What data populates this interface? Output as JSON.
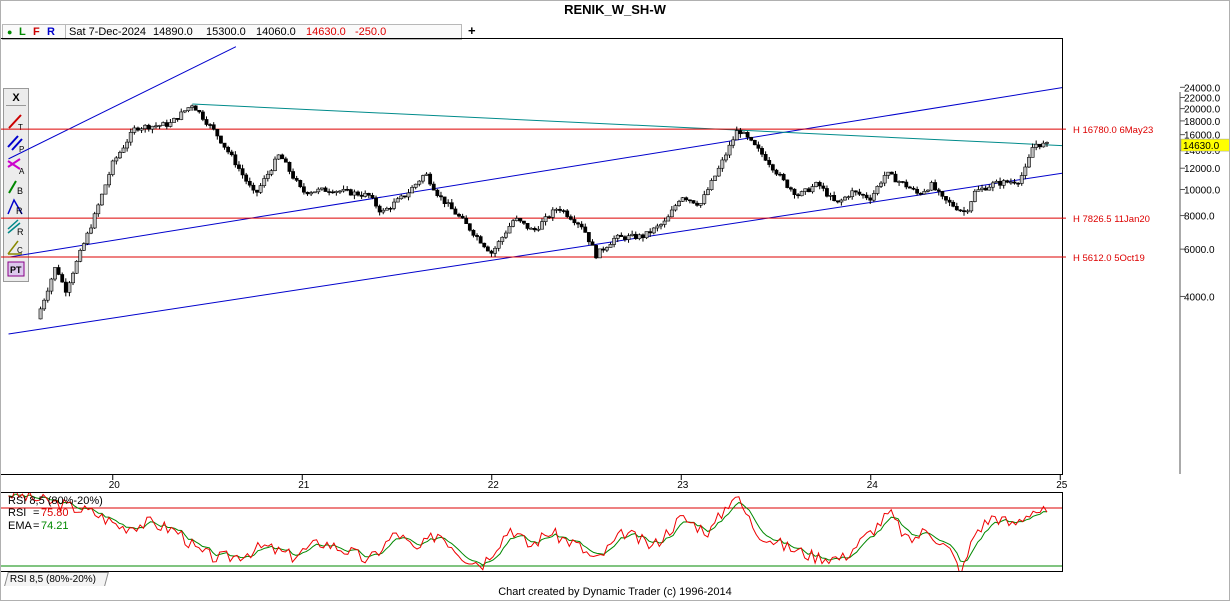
{
  "title": "RENIK_W_SH-W",
  "info_bar": {
    "dot": "●",
    "letters": [
      "L",
      "F",
      "R"
    ],
    "date": "Sat 7-Dec-2024",
    "open": "14890.0",
    "high": "15300.0",
    "low": "14060.0",
    "close": "14630.0",
    "change": "-250.0"
  },
  "add_symbol": "+",
  "toolbar": {
    "close": "X",
    "tools": [
      {
        "name": "trend-line-tool",
        "label": "T",
        "color": "#cc0000"
      },
      {
        "name": "parallel-line-tool",
        "label": "P",
        "color": "#0000cc"
      },
      {
        "name": "arc-tool",
        "label": "A",
        "color": "#cc00cc"
      },
      {
        "name": "b-tool",
        "label": "B",
        "color": "#008800"
      },
      {
        "name": "retrace-tool",
        "label": "R",
        "color": "#0000cc"
      },
      {
        "name": "ratio-tool",
        "label": "R",
        "color": "#008888"
      },
      {
        "name": "cycle-tool",
        "label": "C",
        "color": "#888800"
      },
      {
        "name": "pattern-tool",
        "label": "PT",
        "color": "#880088"
      }
    ]
  },
  "colors": {
    "bull": "#c0c0c0",
    "bear": "#000000",
    "channel": "#0000cc",
    "trendline": "#008b8b",
    "level": "#dd0000",
    "rsi": "#ee0000",
    "ema": "#008800",
    "last_price_bg": "#ffff00"
  },
  "chart_data": [
    {
      "type": "candlestick",
      "title": "RENIK_W_SH-W",
      "y_scale": "log",
      "ylim": [
        2900,
        26000
      ],
      "y_ticks": [
        "24000.0",
        "22000.0",
        "20000.0",
        "18000.0",
        "16000.0",
        "14000.0",
        "12000.0",
        "10000.0",
        "8000.0",
        "6000.0",
        "4000.0"
      ],
      "x_ticks": [
        "20",
        "21",
        "22",
        "23",
        "24",
        "25"
      ],
      "last_price": "14630.0",
      "levels": [
        {
          "value": 16780.0,
          "label": "H 16780.0 6May23"
        },
        {
          "value": 7826.5,
          "label": "H 7826.5 11Jan20"
        },
        {
          "value": 5612.0,
          "label": "H 5612.0 5Oct19"
        }
      ],
      "path": [
        [
          2019.6,
          3300
        ],
        [
          2019.7,
          5200
        ],
        [
          2019.75,
          4200
        ],
        [
          2019.82,
          5600
        ],
        [
          2019.9,
          7800
        ],
        [
          2020.0,
          12500
        ],
        [
          2020.12,
          17000
        ],
        [
          2020.3,
          17500
        ],
        [
          2020.42,
          20800
        ],
        [
          2020.55,
          16000
        ],
        [
          2020.65,
          12500
        ],
        [
          2020.75,
          9500
        ],
        [
          2020.88,
          13500
        ],
        [
          2021.0,
          9800
        ],
        [
          2021.15,
          10000
        ],
        [
          2021.35,
          9500
        ],
        [
          2021.42,
          8200
        ],
        [
          2021.55,
          9600
        ],
        [
          2021.65,
          11500
        ],
        [
          2021.72,
          9500
        ],
        [
          2021.85,
          7600
        ],
        [
          2022.0,
          5800
        ],
        [
          2022.12,
          7800
        ],
        [
          2022.22,
          7000
        ],
        [
          2022.35,
          8600
        ],
        [
          2022.48,
          7300
        ],
        [
          2022.55,
          5700
        ],
        [
          2022.65,
          6600
        ],
        [
          2022.8,
          6700
        ],
        [
          2022.92,
          7600
        ],
        [
          2023.0,
          9500
        ],
        [
          2023.1,
          8800
        ],
        [
          2023.2,
          12000
        ],
        [
          2023.3,
          16800
        ],
        [
          2023.45,
          13000
        ],
        [
          2023.55,
          10500
        ],
        [
          2023.62,
          9500
        ],
        [
          2023.72,
          10500
        ],
        [
          2023.82,
          8800
        ],
        [
          2023.9,
          9800
        ],
        [
          2024.0,
          9300
        ],
        [
          2024.08,
          11500
        ],
        [
          2024.2,
          10200
        ],
        [
          2024.25,
          9600
        ],
        [
          2024.32,
          10400
        ],
        [
          2024.38,
          9200
        ],
        [
          2024.45,
          8600
        ],
        [
          2024.5,
          8200
        ],
        [
          2024.55,
          9800
        ],
        [
          2024.65,
          10500
        ],
        [
          2024.78,
          10800
        ],
        [
          2024.82,
          12000
        ],
        [
          2024.86,
          14800
        ],
        [
          2024.93,
          14630
        ]
      ],
      "annotations": [
        {
          "type": "channel-line",
          "from": [
            2019.45,
            13000
          ],
          "to": [
            2020.65,
            34000
          ]
        },
        {
          "type": "channel-line",
          "from": [
            2019.45,
            5600
          ],
          "to": [
            2025.25,
            25500
          ]
        },
        {
          "type": "channel-line",
          "from": [
            2019.45,
            2900
          ],
          "to": [
            2025.25,
            12200
          ]
        },
        {
          "type": "trend-line",
          "from": [
            2020.42,
            20800
          ],
          "to": [
            2025.25,
            14300
          ]
        }
      ]
    },
    {
      "type": "line",
      "title": "RSI 8,5 (80%-20%)",
      "series": [
        {
          "name": "RSI",
          "value": "75.80"
        },
        {
          "name": "EMA",
          "value": "74.21"
        }
      ],
      "ylim": [
        0,
        100
      ],
      "bands": [
        80,
        20
      ],
      "path": [
        [
          2019.45,
          95
        ],
        [
          2019.7,
          85
        ],
        [
          2019.9,
          75
        ],
        [
          2020.05,
          60
        ],
        [
          2020.2,
          65
        ],
        [
          2020.35,
          55
        ],
        [
          2020.45,
          35
        ],
        [
          2020.55,
          28
        ],
        [
          2020.65,
          30
        ],
        [
          2020.8,
          40
        ],
        [
          2020.95,
          30
        ],
        [
          2021.1,
          45
        ],
        [
          2021.25,
          35
        ],
        [
          2021.35,
          25
        ],
        [
          2021.5,
          55
        ],
        [
          2021.6,
          35
        ],
        [
          2021.72,
          55
        ],
        [
          2021.85,
          30
        ],
        [
          2021.95,
          22
        ],
        [
          2022.1,
          60
        ],
        [
          2022.2,
          40
        ],
        [
          2022.3,
          55
        ],
        [
          2022.45,
          42
        ],
        [
          2022.55,
          25
        ],
        [
          2022.7,
          55
        ],
        [
          2022.85,
          40
        ],
        [
          2023.0,
          70
        ],
        [
          2023.15,
          55
        ],
        [
          2023.28,
          95
        ],
        [
          2023.4,
          55
        ],
        [
          2023.55,
          40
        ],
        [
          2023.7,
          30
        ],
        [
          2023.85,
          28
        ],
        [
          2024.0,
          55
        ],
        [
          2024.1,
          75
        ],
        [
          2024.2,
          45
        ],
        [
          2024.3,
          58
        ],
        [
          2024.42,
          35
        ],
        [
          2024.48,
          12
        ],
        [
          2024.55,
          55
        ],
        [
          2024.65,
          72
        ],
        [
          2024.75,
          62
        ],
        [
          2024.85,
          78
        ],
        [
          2024.93,
          75.8
        ]
      ]
    }
  ],
  "indicator_tab": "RSI 8,5 (80%-20%)",
  "footer": "Chart created by Dynamic Trader  (c) 1996-2014"
}
